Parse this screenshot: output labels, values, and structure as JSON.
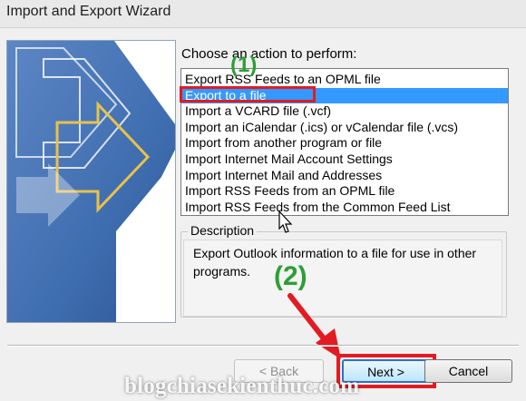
{
  "window": {
    "title": "Import and Export Wizard"
  },
  "main": {
    "action_label": "Choose an action to perform:",
    "actions": [
      "Export RSS Feeds to an OPML file",
      "Export to a file",
      "Import a VCARD file (.vcf)",
      "Import an iCalendar (.ics) or vCalendar file (.vcs)",
      "Import from another program or file",
      "Import Internet Mail Account Settings",
      "Import Internet Mail and Addresses",
      "Import RSS Feeds from an OPML file",
      "Import RSS Feeds from the Common Feed List"
    ],
    "selected_action": "Export to a file",
    "description_label": "Description",
    "description_text": "Export Outlook information to a file for use in other programs."
  },
  "buttons": {
    "back": "< Back",
    "next": "Next >",
    "cancel": "Cancel"
  },
  "annotations": {
    "step1": "(1)",
    "step2": "(2)",
    "highlight_color": "#e21b23",
    "step_color": "#2e9e37"
  },
  "watermark": "blogchiasekienthuc.com",
  "colors": {
    "selection": "#3399ff",
    "banner_blue": "#3f6eb0"
  }
}
